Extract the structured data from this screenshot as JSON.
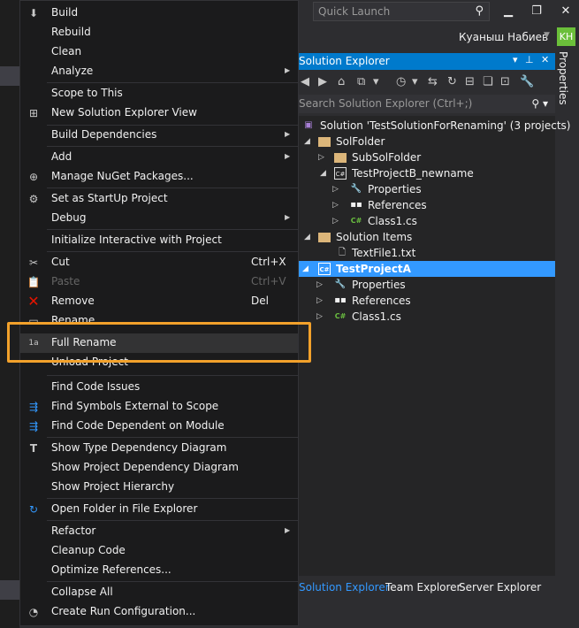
{
  "window": {
    "quick_launch_placeholder": "Quick Launch",
    "user_name": "Куаныш Набиев",
    "avatar_initials": "KH",
    "properties_tab": "Properties"
  },
  "solution_explorer": {
    "title": "Solution Explorer",
    "search_placeholder": "Search Solution Explorer (Ctrl+;)",
    "tree": [
      {
        "label": "Solution 'TestSolutionForRenaming' (3 projects)",
        "icon": "solution-icon",
        "expanded": null,
        "selected": false
      },
      {
        "label": "SolFolder",
        "icon": "folder-icon",
        "expanded": true,
        "selected": false
      },
      {
        "label": "SubSolFolder",
        "icon": "folder-icon",
        "expanded": false,
        "selected": false
      },
      {
        "label": "TestProjectB_newname",
        "icon": "csharp-project-icon",
        "expanded": true,
        "selected": false
      },
      {
        "label": "Properties",
        "icon": "wrench-icon",
        "expanded": false,
        "selected": false
      },
      {
        "label": "References",
        "icon": "references-icon",
        "expanded": false,
        "selected": false
      },
      {
        "label": "Class1.cs",
        "icon": "csharp-file-icon",
        "expanded": false,
        "selected": false
      },
      {
        "label": "Solution Items",
        "icon": "folder-icon",
        "expanded": true,
        "selected": false
      },
      {
        "label": "TextFile1.txt",
        "icon": "text-file-icon",
        "expanded": null,
        "selected": false
      },
      {
        "label": "TestProjectA",
        "icon": "csharp-project-icon",
        "expanded": true,
        "selected": true
      },
      {
        "label": "Properties",
        "icon": "wrench-icon",
        "expanded": false,
        "selected": false
      },
      {
        "label": "References",
        "icon": "references-icon",
        "expanded": false,
        "selected": false
      },
      {
        "label": "Class1.cs",
        "icon": "csharp-file-icon",
        "expanded": false,
        "selected": false
      }
    ],
    "bottom_tabs": [
      "Solution Explorer",
      "Team Explorer",
      "Server Explorer"
    ]
  },
  "context_menu": {
    "items": [
      {
        "label": "Build",
        "icon": "build-icon"
      },
      {
        "label": "Rebuild"
      },
      {
        "label": "Clean"
      },
      {
        "label": "Analyze",
        "submenu": true
      },
      {
        "label": "Scope to This"
      },
      {
        "label": "New Solution Explorer View",
        "icon": "new-view-icon"
      },
      {
        "label": "Build Dependencies",
        "submenu": true
      },
      {
        "label": "Add",
        "submenu": true
      },
      {
        "label": "Manage NuGet Packages...",
        "icon": "nuget-icon"
      },
      {
        "label": "Set as StartUp Project",
        "icon": "gear-icon"
      },
      {
        "label": "Debug",
        "submenu": true
      },
      {
        "label": "Initialize Interactive with Project"
      },
      {
        "label": "Cut",
        "icon": "scissors-icon",
        "shortcut": "Ctrl+X"
      },
      {
        "label": "Paste",
        "icon": "paste-icon",
        "shortcut": "Ctrl+V",
        "disabled": true
      },
      {
        "label": "Remove",
        "icon": "remove-icon",
        "shortcut": "Del"
      },
      {
        "label": "Rename",
        "icon": "rename-icon"
      },
      {
        "label": "Full Rename",
        "icon": "full-rename-icon",
        "highlighted": true
      },
      {
        "label": "Unload Project"
      },
      {
        "label": "Find Code Issues"
      },
      {
        "label": "Find Symbols External to Scope",
        "icon": "find-symbols-icon"
      },
      {
        "label": "Find Code Dependent on Module",
        "icon": "find-dependent-icon"
      },
      {
        "label": "Show Type Dependency Diagram",
        "icon": "diagram-icon"
      },
      {
        "label": "Show Project Dependency Diagram"
      },
      {
        "label": "Show Project Hierarchy"
      },
      {
        "label": "Open Folder in File Explorer",
        "icon": "refresh-folder-icon"
      },
      {
        "label": "Refactor",
        "submenu": true
      },
      {
        "label": "Cleanup Code"
      },
      {
        "label": "Optimize References..."
      },
      {
        "label": "Collapse All"
      },
      {
        "label": "Create Run Configuration...",
        "icon": "run-config-icon"
      }
    ]
  },
  "colors": {
    "accent": "#007acc",
    "selection": "#3399ff",
    "callout": "#f2a12b",
    "remove_red": "#e51400"
  }
}
